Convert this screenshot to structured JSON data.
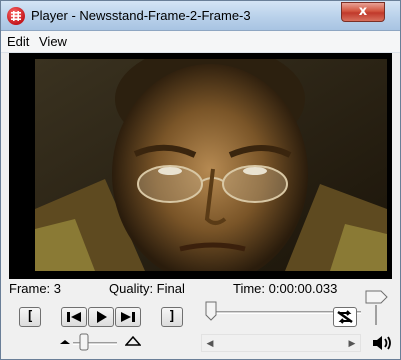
{
  "window": {
    "title": "Player - Newsstand-Frame-2-Frame-3",
    "close_glyph": "x"
  },
  "menu": {
    "items": [
      "Edit",
      "View"
    ]
  },
  "status": {
    "frame_label": "Frame: 3",
    "quality_label": "Quality: Final",
    "time_label": "Time: 0:00:00.033"
  },
  "controls": {
    "mark_in_glyph": "[",
    "mark_out_glyph": "]",
    "icons": [
      "step-back-icon",
      "play-icon",
      "step-forward-icon",
      "loop-icon",
      "volume-icon",
      "app-icon"
    ]
  },
  "colors": {
    "title_gradient_top": "#d4e4f5",
    "close_button": "#c0392b",
    "app_icon": "#c4161c",
    "video_background": "#000000"
  }
}
